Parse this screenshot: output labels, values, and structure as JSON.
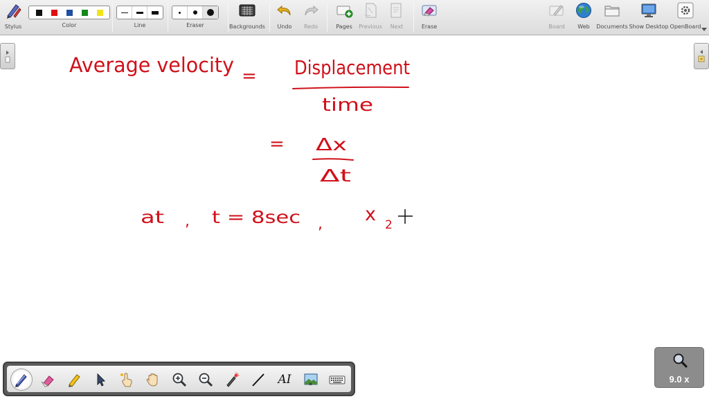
{
  "toolbar": {
    "stylus": "Stylus",
    "color": "Color",
    "line": "Line",
    "eraser": "Eraser",
    "backgrounds": "Backgrounds",
    "undo": "Undo",
    "redo": "Redo",
    "pages": "Pages",
    "previous": "Previous",
    "next": "Next",
    "erase": "Erase",
    "board": "Board",
    "web": "Web",
    "documents": "Documents",
    "show_desktop": "Show Desktop",
    "openboard": "OpenBoard"
  },
  "colors": {
    "palette": [
      "#111111",
      "#e01010",
      "#1f4fa0",
      "#138a1b",
      "#f3e41a"
    ],
    "ink": "#d0101a"
  },
  "icons": {
    "stylus": "stylus-icon",
    "backgrounds": "backgrounds-icon",
    "undo": "undo-arrow-icon",
    "redo": "redo-arrow-icon",
    "pages": "add-page-icon",
    "previous": "previous-page-icon",
    "next": "next-page-icon",
    "erase": "erase-board-icon",
    "board": "board-icon",
    "web": "globe-icon",
    "documents": "folder-icon",
    "show_desktop": "monitor-icon",
    "openboard": "gear-icon"
  },
  "palette_tools": [
    "pen-tool-icon",
    "eraser-tool-icon",
    "marker-tool-icon",
    "selector-tool-icon",
    "interact-tool-icon",
    "hand-tool-icon",
    "zoom-in-tool-icon",
    "zoom-out-tool-icon",
    "laser-pointer-tool-icon",
    "line-tool-icon",
    "text-tool-icon",
    "capture-tool-icon",
    "keyboard-tool-icon"
  ],
  "palette_text_tool": "AI",
  "zoom": {
    "label": "9.0 x"
  },
  "handwriting": {
    "line1_left": "Average velocity",
    "line1_eq": "=",
    "numerator": "Displacement",
    "denominator": "time",
    "line2_eq": "=",
    "delta_x": "Δx",
    "delta_t": "Δt",
    "line3_at": "at",
    "line3_comma1": ",",
    "line3_t": "t = 8sec",
    "line3_comma2": ",",
    "line3_x": "x",
    "line3_sub": "2"
  }
}
